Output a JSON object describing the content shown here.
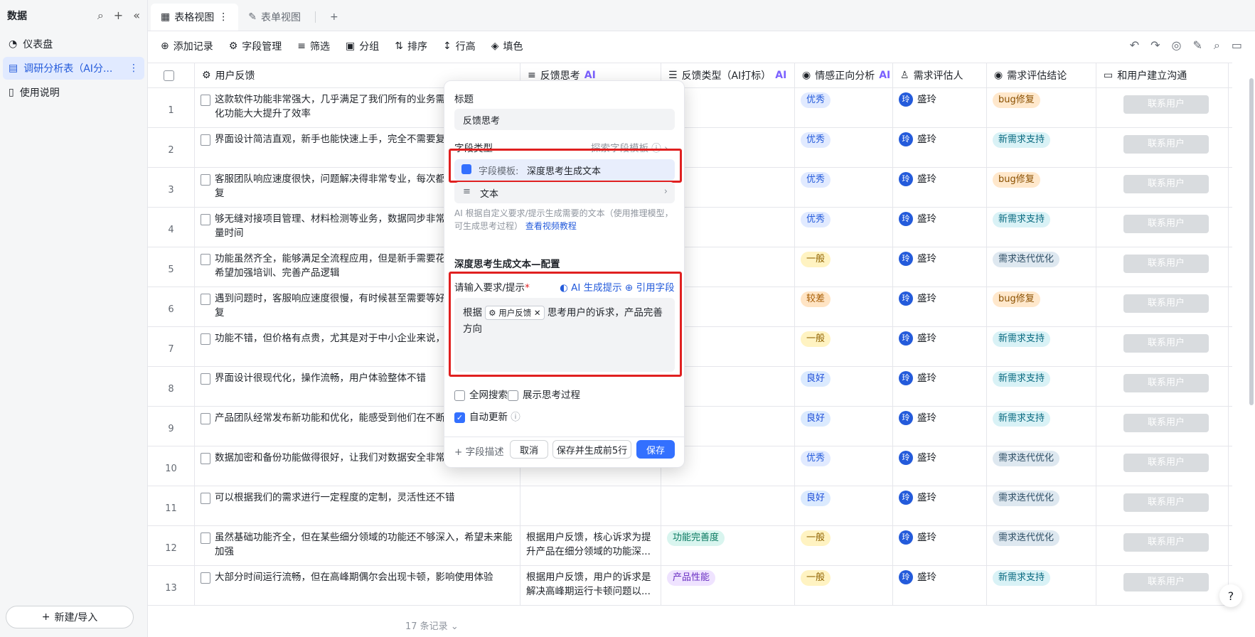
{
  "sidebar": {
    "title": "数据",
    "items": [
      {
        "label": "仪表盘"
      },
      {
        "label": "调研分析表（AI分..."
      },
      {
        "label": "使用说明"
      }
    ],
    "new_label": "新建/导入"
  },
  "tabs": [
    {
      "label": "表格视图"
    },
    {
      "label": "表单视图"
    }
  ],
  "toolbar": {
    "add": "添加记录",
    "fields": "字段管理",
    "filter": "筛选",
    "group": "分组",
    "sort": "排序",
    "rowh": "行高",
    "fill": "填色"
  },
  "headers": {
    "h1": "用户反馈",
    "h2": "反馈思考",
    "h3": "反馈类型（AI打标）",
    "h4": "情感正向分析",
    "h5": "需求评估人",
    "h6": "需求评估结论",
    "h7": "和用户建立沟通",
    "ai": "AI"
  },
  "rows": [
    {
      "n": "1",
      "text": "这款软件功能非常强大，几乎满足了我们所有的业务需求，尤其是自动化功能大大提升了效率",
      "c2": "",
      "c3": "",
      "sent": "优秀",
      "person": "盛玲",
      "conc": "bug修复",
      "btn": "联系用户"
    },
    {
      "n": "2",
      "text": "界面设计简洁直观，新手也能快速上手，完全不需要复杂的培训",
      "c2": "",
      "c3": "",
      "sent": "优秀",
      "person": "盛玲",
      "conc": "新需求支持",
      "btn": "联系用户"
    },
    {
      "n": "3",
      "text": "客服团队响应速度很快，问题解决得非常专业，每次都能得到满意的答复",
      "c2": "",
      "c3": "",
      "sent": "优秀",
      "person": "盛玲",
      "conc": "bug修复",
      "btn": "联系用户"
    },
    {
      "n": "4",
      "text": "够无缝对接项目管理、材料检测等业务，数据同步非常方便，节省了大量时间",
      "c2": "",
      "c3": "",
      "sent": "优秀",
      "person": "盛玲",
      "conc": "新需求支持",
      "btn": "联系用户"
    },
    {
      "n": "5",
      "text": "功能虽然齐全，能够满足全流程应用，但是新手需要花很长时间学习，希望加强培训、完善产品逻辑",
      "c2": "",
      "c3": "",
      "sent": "一般",
      "person": "盛玲",
      "conc": "需求迭代优化",
      "btn": "联系用户"
    },
    {
      "n": "6",
      "text": "遇到问题时，客服响应速度很慢，有时候甚至需要等好几天才能得到回复",
      "c2": "",
      "c3": "",
      "sent": "较差",
      "person": "盛玲",
      "conc": "bug修复",
      "btn": "联系用户"
    },
    {
      "n": "7",
      "text": "功能不错，但价格有点贵，尤其是对于中小企业来说，成本压力较大",
      "c2": "",
      "c3": "",
      "sent": "一般",
      "person": "盛玲",
      "conc": "新需求支持",
      "btn": "联系用户"
    },
    {
      "n": "8",
      "text": "界面设计很现代化，操作流畅，用户体验整体不错",
      "c2": "",
      "c3": "",
      "sent": "良好",
      "person": "盛玲",
      "conc": "新需求支持",
      "btn": "联系用户"
    },
    {
      "n": "9",
      "text": "产品团队经常发布新功能和优化，能感受到他们在不断改进",
      "c2": "",
      "c3": "",
      "sent": "良好",
      "person": "盛玲",
      "conc": "新需求支持",
      "btn": "联系用户"
    },
    {
      "n": "10",
      "text": "数据加密和备份功能做得很好，让我们对数据安全非常放心",
      "c2": "",
      "c3": "",
      "sent": "优秀",
      "person": "盛玲",
      "conc": "需求迭代优化",
      "btn": "联系用户"
    },
    {
      "n": "11",
      "text": "可以根据我们的需求进行一定程度的定制，灵活性还不错",
      "c2": "",
      "c3": "",
      "sent": "良好",
      "person": "盛玲",
      "conc": "需求迭代优化",
      "btn": "联系用户"
    },
    {
      "n": "12",
      "text": "虽然基础功能齐全，但在某些细分领域的功能还不够深入，希望未来能加强",
      "c2": "根据用户反馈，核心诉求为提升产品在细分领域的功能深...",
      "c3": "功能完善度",
      "sent": "一般",
      "person": "盛玲",
      "conc": "需求迭代优化",
      "btn": "联系用户"
    },
    {
      "n": "13",
      "text": "大部分时间运行流畅，但在高峰期偶尔会出现卡顿，影响使用体验",
      "c2": "根据用户反馈，用户的诉求是解决高峰期运行卡顿问题以...",
      "c3": "产品性能",
      "sent": "一般",
      "person": "盛玲",
      "conc": "新需求支持",
      "btn": "联系用户"
    }
  ],
  "footer": "17 条记录",
  "panel": {
    "title_label": "标题",
    "title_value": "反馈思考",
    "type_label": "字段类型",
    "explore": "探索字段模板",
    "template_prefix": "字段模板:",
    "template_value": "深度思考生成文本",
    "text_type": "文本",
    "desc": "AI 根据自定义要求/提示生成需要的文本（使用推理模型，可生成思考过程）",
    "desc_link": "查看视频教程",
    "config_title": "深度思考生成文本—配置",
    "prompt_label": "请输入要求/提示",
    "ai_gen": "AI 生成提示",
    "ref_field": "引用字段",
    "prompt_pre": "根据",
    "prompt_chip": "用户反馈",
    "prompt_post": "思考用户的诉求，产品完善方向",
    "opt_web": "全网搜索",
    "opt_show": "展示思考过程",
    "opt_auto": "自动更新",
    "field_desc": "字段描述",
    "cancel": "取消",
    "save_gen": "保存并生成前5行",
    "save": "保存"
  }
}
